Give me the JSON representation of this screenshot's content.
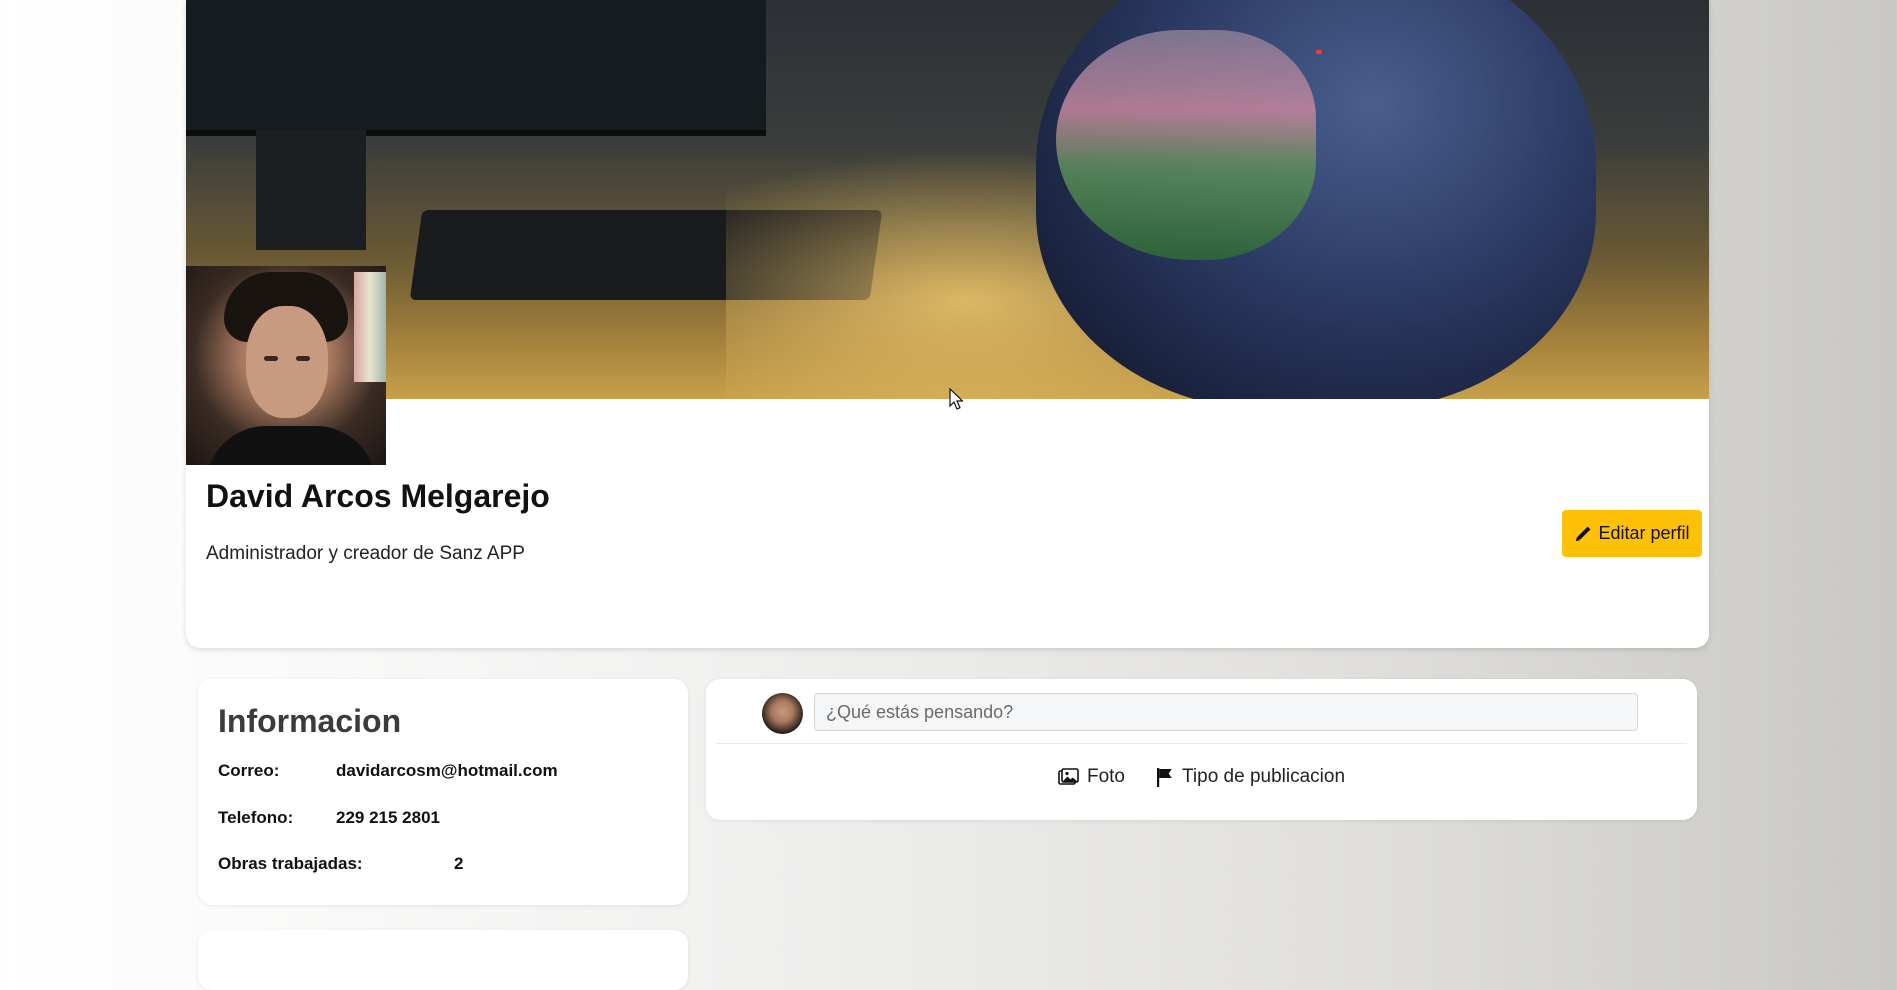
{
  "profile": {
    "name": "David Arcos Melgarejo",
    "bio": "Administrador y creador de Sanz APP",
    "edit_button": "Editar perfil",
    "edit_icon": "pencil-icon"
  },
  "info": {
    "title": "Informacion",
    "rows": [
      {
        "label": "Correo:",
        "value": "davidarcosm@hotmail.com"
      },
      {
        "label": "Telefono:",
        "value": "229 215 2801"
      },
      {
        "label": "Obras trabajadas:",
        "value": "2"
      }
    ]
  },
  "post": {
    "placeholder": "¿Qué estás pensando?",
    "actions": [
      {
        "label": "Foto",
        "icon": "image-icon"
      },
      {
        "label": "Tipo de publicacion",
        "icon": "flag-icon"
      }
    ]
  },
  "colors": {
    "accent": "#ffc107",
    "card": "#ffffff"
  }
}
